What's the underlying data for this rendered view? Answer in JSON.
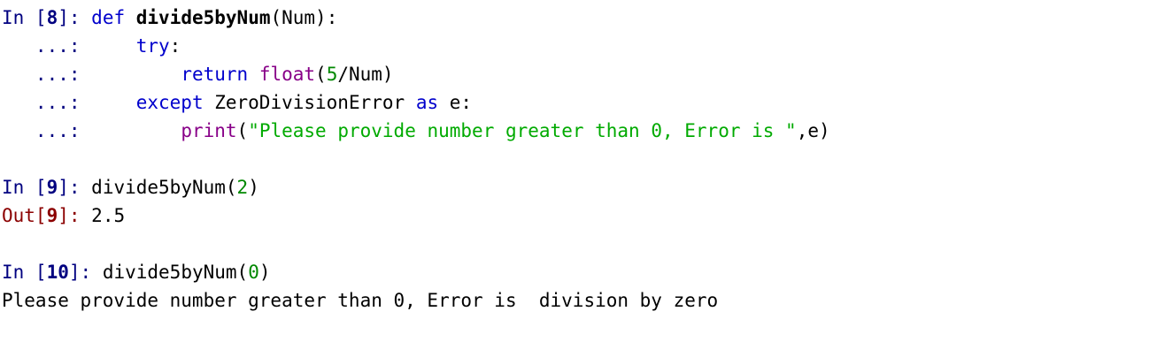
{
  "cell8": {
    "prompt_prefix": "In [",
    "prompt_num": "8",
    "prompt_suffix": "]: ",
    "kw_def": "def",
    "fn_name": "divide5byNum",
    "fn_args": "(Num):",
    "cont_prompt": "   ...:",
    "kw_try": "try",
    "colon": ":",
    "kw_return": "return",
    "builtin_float": "float",
    "paren_open": "(",
    "num5": "5",
    "div_num": "/Num)",
    "kw_except": "except",
    "exc_name": " ZeroDivisionError ",
    "kw_as": "as",
    "exc_var": " e:",
    "builtin_print": "print",
    "print_str": "\"Please provide number greater than 0, Error is \"",
    "print_tail": ",e)"
  },
  "cell9": {
    "prompt_prefix": "In [",
    "prompt_num": "9",
    "prompt_suffix": "]: ",
    "call": "divide5byNum(",
    "arg": "2",
    "close": ")",
    "out_prefix": "Out[",
    "out_num": "9",
    "out_suffix": "]: ",
    "out_value": "2.5"
  },
  "cell10": {
    "prompt_prefix": "In [",
    "prompt_num": "10",
    "prompt_suffix": "]: ",
    "call": "divide5byNum(",
    "arg": "0",
    "close": ")",
    "stdout": "Please provide number greater than 0, Error is  division by zero"
  }
}
